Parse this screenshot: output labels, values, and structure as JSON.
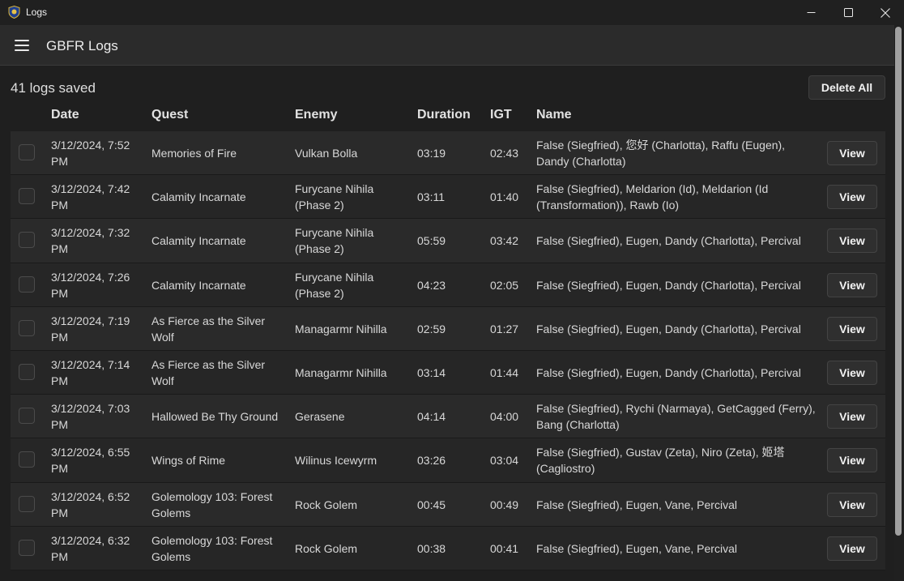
{
  "window": {
    "title": "Logs"
  },
  "header": {
    "app_name": "GBFR Logs"
  },
  "toolbar": {
    "count_label": "41 logs saved",
    "delete_all_label": "Delete All"
  },
  "columns": {
    "date": "Date",
    "quest": "Quest",
    "enemy": "Enemy",
    "duration": "Duration",
    "igt": "IGT",
    "name": "Name"
  },
  "view_label": "View",
  "rows": [
    {
      "date": "3/12/2024, 7:52 PM",
      "quest": "Memories of Fire",
      "enemy": "Vulkan Bolla",
      "duration": "03:19",
      "igt": "02:43",
      "name": "False (Siegfried), 您好 (Charlotta), Raffu (Eugen), Dandy (Charlotta)"
    },
    {
      "date": "3/12/2024, 7:42 PM",
      "quest": "Calamity Incarnate",
      "enemy": "Furycane Nihila (Phase 2)",
      "duration": "03:11",
      "igt": "01:40",
      "name": "False (Siegfried), Meldarion (Id), Meldarion (Id (Transformation)), Rawb (Io)"
    },
    {
      "date": "3/12/2024, 7:32 PM",
      "quest": "Calamity Incarnate",
      "enemy": "Furycane Nihila (Phase 2)",
      "duration": "05:59",
      "igt": "03:42",
      "name": "False (Siegfried), Eugen, Dandy (Charlotta), Percival"
    },
    {
      "date": "3/12/2024, 7:26 PM",
      "quest": "Calamity Incarnate",
      "enemy": "Furycane Nihila (Phase 2)",
      "duration": "04:23",
      "igt": "02:05",
      "name": "False (Siegfried), Eugen, Dandy (Charlotta), Percival"
    },
    {
      "date": "3/12/2024, 7:19 PM",
      "quest": "As Fierce as the Silver Wolf",
      "enemy": "Managarmr Nihilla",
      "duration": "02:59",
      "igt": "01:27",
      "name": "False (Siegfried), Eugen, Dandy (Charlotta), Percival"
    },
    {
      "date": "3/12/2024, 7:14 PM",
      "quest": "As Fierce as the Silver Wolf",
      "enemy": "Managarmr Nihilla",
      "duration": "03:14",
      "igt": "01:44",
      "name": "False (Siegfried), Eugen, Dandy (Charlotta), Percival"
    },
    {
      "date": "3/12/2024, 7:03 PM",
      "quest": "Hallowed Be Thy Ground",
      "enemy": "Gerasene",
      "duration": "04:14",
      "igt": "04:00",
      "name": "False (Siegfried), Rychi (Narmaya), GetCagged (Ferry), Bang (Charlotta)"
    },
    {
      "date": "3/12/2024, 6:55 PM",
      "quest": "Wings of Rime",
      "enemy": "Wilinus Icewyrm",
      "duration": "03:26",
      "igt": "03:04",
      "name": "False (Siegfried), Gustav (Zeta), Niro (Zeta), 姬塔 (Cagliostro)"
    },
    {
      "date": "3/12/2024, 6:52 PM",
      "quest": "Golemology 103: Forest Golems",
      "enemy": "Rock Golem",
      "duration": "00:45",
      "igt": "00:49",
      "name": "False (Siegfried), Eugen, Vane, Percival"
    },
    {
      "date": "3/12/2024, 6:32 PM",
      "quest": "Golemology 103: Forest Golems",
      "enemy": "Rock Golem",
      "duration": "00:38",
      "igt": "00:41",
      "name": "False (Siegfried), Eugen, Vane, Percival"
    }
  ]
}
